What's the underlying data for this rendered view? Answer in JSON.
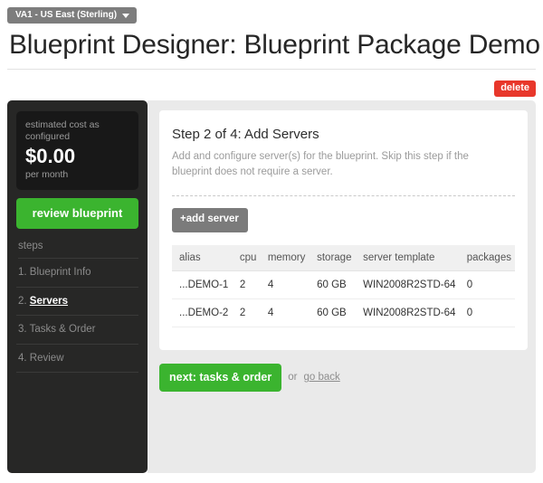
{
  "topbar": {
    "region_label": "VA1 - US East (Sterling)",
    "caret_icon": "chevron-down-icon"
  },
  "header": {
    "title": "Blueprint Designer: Blueprint Package Demo",
    "delete_label": "delete"
  },
  "sidebar": {
    "cost": {
      "label": "estimated cost as configured",
      "amount": "$0.00",
      "period": "per month"
    },
    "review_button": "review blueprint",
    "steps_label": "steps",
    "steps": [
      {
        "number": "1.",
        "name": "Blueprint Info",
        "active": false
      },
      {
        "number": "2.",
        "name": "Servers",
        "active": true
      },
      {
        "number": "3.",
        "name": "Tasks & Order",
        "active": false
      },
      {
        "number": "4.",
        "name": "Review",
        "active": false
      }
    ]
  },
  "main": {
    "card_title": "Step 2 of 4: Add Servers",
    "card_description": "Add and configure server(s) for the blueprint. Skip this step if the blueprint does not require a server.",
    "add_server_button": "+add server",
    "table": {
      "columns": [
        "alias",
        "cpu",
        "memory",
        "storage",
        "server template",
        "packages"
      ],
      "rows": [
        [
          "...DEMO-1",
          "2",
          "4",
          "60 GB",
          "WIN2008R2STD-64",
          "0"
        ],
        [
          "...DEMO-2",
          "2",
          "4",
          "60 GB",
          "WIN2008R2STD-64",
          "0"
        ]
      ]
    },
    "next_button": "next: tasks & order",
    "or_text": "or",
    "go_back_link": "go back"
  },
  "colors": {
    "green": "#3bb42f",
    "red": "#e8372b",
    "sidebar_dark": "#272726",
    "cost_box_dark": "#181818",
    "gray_button": "#7b7b7b",
    "content_bg": "#eaeaea"
  }
}
